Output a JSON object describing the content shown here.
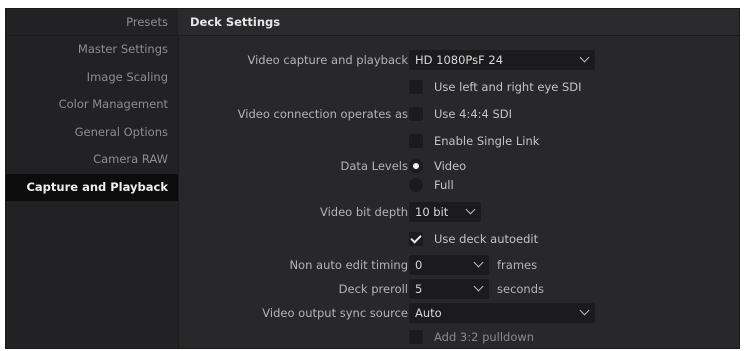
{
  "sidebar": {
    "header": "Presets",
    "items": [
      {
        "label": "Master Settings"
      },
      {
        "label": "Image Scaling"
      },
      {
        "label": "Color Management"
      },
      {
        "label": "General Options"
      },
      {
        "label": "Camera RAW"
      },
      {
        "label": "Capture and Playback"
      }
    ],
    "active_index": 5
  },
  "main": {
    "title": "Deck Settings",
    "video_capture_playback": {
      "label": "Video capture and playback",
      "value": "HD 1080PsF 24"
    },
    "use_left_right_eye": {
      "label": "Use left and right eye SDI",
      "checked": false
    },
    "video_connection": {
      "label": "Video connection operates as",
      "option": "Use 4:4:4 SDI",
      "checked": false
    },
    "enable_single_link": {
      "label": "Enable Single Link",
      "checked": false
    },
    "data_levels": {
      "label": "Data Levels",
      "options": [
        "Video",
        "Full"
      ],
      "selected": "Video"
    },
    "video_bit_depth": {
      "label": "Video bit depth",
      "value": "10 bit"
    },
    "use_deck_autoedit": {
      "label": "Use deck autoedit",
      "checked": true
    },
    "non_auto_edit_timing": {
      "label": "Non auto edit timing",
      "value": "0",
      "unit": "frames"
    },
    "deck_preroll": {
      "label": "Deck preroll",
      "value": "5",
      "unit": "seconds"
    },
    "video_output_sync": {
      "label": "Video output sync source",
      "value": "Auto"
    },
    "add_pulldown": {
      "label": "Add 3:2 pulldown",
      "checked": false
    }
  },
  "colors": {
    "background": "#28282a",
    "sidebar": "#222224",
    "active_item": "#0c0c0d",
    "control": "#1b1b1d"
  }
}
